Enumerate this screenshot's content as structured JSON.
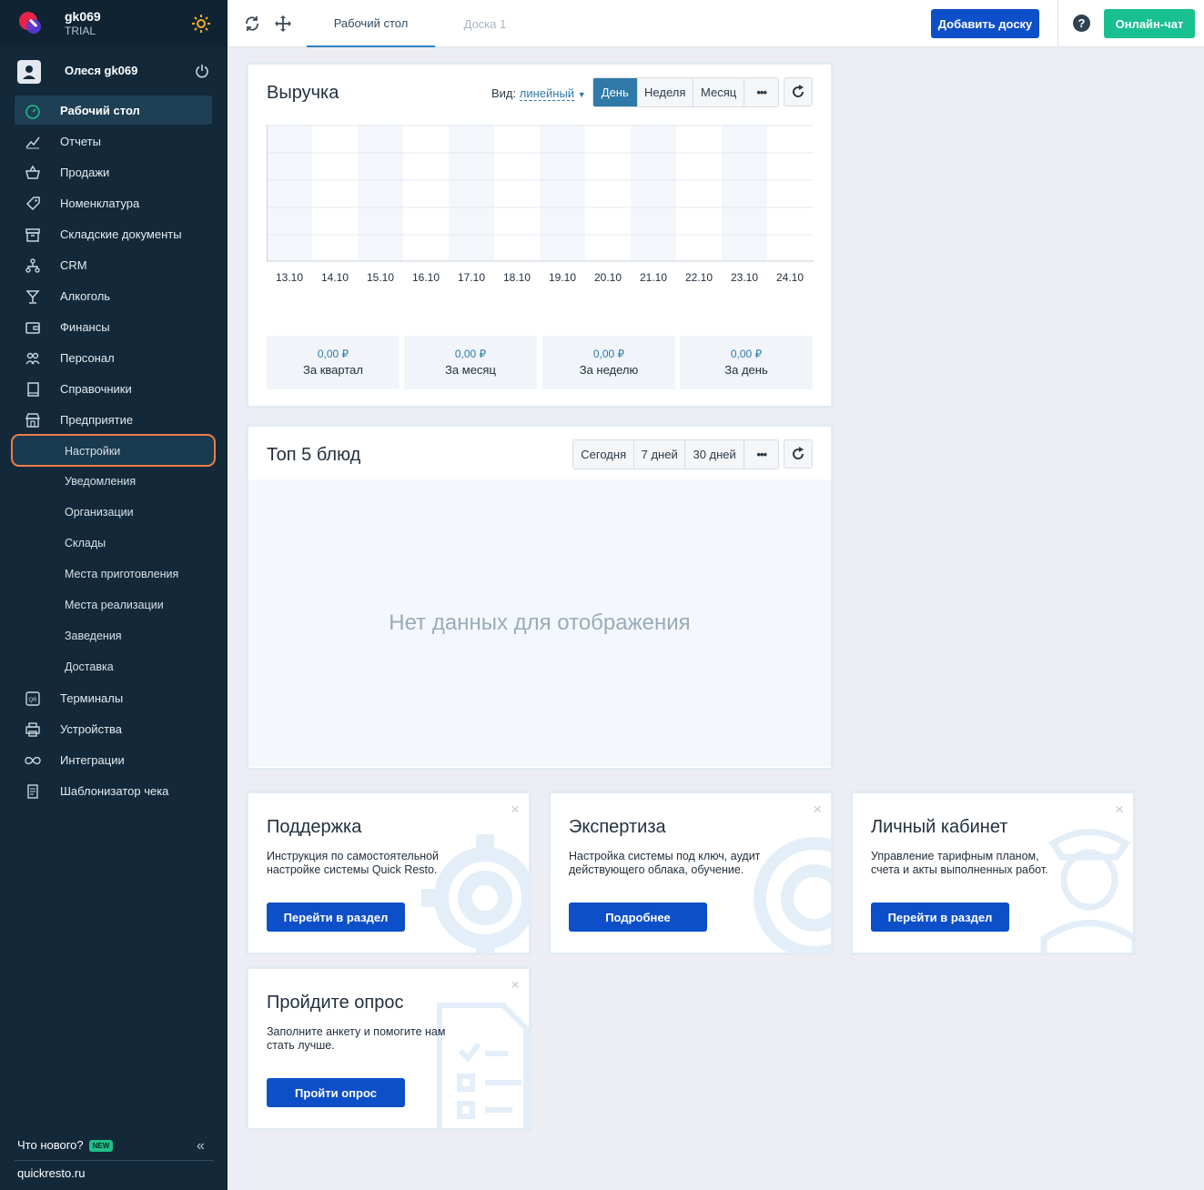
{
  "account": {
    "name": "gk069",
    "plan": "TRIAL"
  },
  "user": {
    "name": "Олеся gk069"
  },
  "nav": {
    "items": [
      {
        "label": "Рабочий стол",
        "icon": "dashboard-icon"
      },
      {
        "label": "Отчеты",
        "icon": "chart-icon"
      },
      {
        "label": "Продажи",
        "icon": "basket-icon"
      },
      {
        "label": "Номенклатура",
        "icon": "tag-icon"
      },
      {
        "label": "Складские документы",
        "icon": "archive-icon"
      },
      {
        "label": "CRM",
        "icon": "crm-icon"
      },
      {
        "label": "Алкоголь",
        "icon": "glass-icon"
      },
      {
        "label": "Финансы",
        "icon": "wallet-icon"
      },
      {
        "label": "Персонал",
        "icon": "people-icon"
      },
      {
        "label": "Справочники",
        "icon": "book-icon"
      },
      {
        "label": "Предприятие",
        "icon": "store-icon"
      }
    ],
    "sub_items": [
      "Настройки",
      "Уведомления",
      "Организации",
      "Склады",
      "Места приготовления",
      "Места реализации",
      "Заведения",
      "Доставка"
    ],
    "items_after": [
      {
        "label": "Терминалы",
        "icon": "qr-icon"
      },
      {
        "label": "Устройства",
        "icon": "printer-icon"
      },
      {
        "label": "Интеграции",
        "icon": "infinity-icon"
      },
      {
        "label": "Шаблонизатор чека",
        "icon": "receipt-icon"
      }
    ]
  },
  "footer": {
    "whats_new": "Что нового?",
    "new_badge": "NEW",
    "site": "quickresto.ru"
  },
  "topbar": {
    "tabs": [
      "Рабочий стол",
      "Доска 1"
    ],
    "add_board": "Добавить доску",
    "help": "?",
    "chat": "Онлайн-чат"
  },
  "revenue": {
    "title": "Выручка",
    "view_label": "Вид:",
    "view_value": "линейный",
    "periods": [
      "День",
      "Неделя",
      "Месяц"
    ],
    "more": "•••",
    "stats": [
      {
        "value": "0,00 ₽",
        "label": "За квартал"
      },
      {
        "value": "0,00 ₽",
        "label": "За месяц"
      },
      {
        "value": "0,00 ₽",
        "label": "За неделю"
      },
      {
        "value": "0,00 ₽",
        "label": "За день"
      }
    ]
  },
  "chart_data": {
    "type": "bar",
    "categories": [
      "13.10",
      "14.10",
      "15.10",
      "16.10",
      "17.10",
      "18.10",
      "19.10",
      "20.10",
      "21.10",
      "22.10",
      "23.10",
      "24.10"
    ],
    "values": [
      0,
      0,
      0,
      0,
      0,
      0,
      0,
      0,
      0,
      0,
      0,
      0
    ],
    "title": "Выручка",
    "grid": true
  },
  "top5": {
    "title": "Топ 5 блюд",
    "periods": [
      "Сегодня",
      "7 дней",
      "30 дней"
    ],
    "more": "•••",
    "empty": "Нет данных для отображения"
  },
  "promos": [
    {
      "title": "Поддержка",
      "desc": "Инструкция по самостоятельной настройке системы Quick Resto.",
      "button": "Перейти в раздел",
      "close": "×"
    },
    {
      "title": "Экспертиза",
      "desc": "Настройка системы под ключ, аудит действующего облака, обучение.",
      "button": "Подробнее",
      "close": "×"
    },
    {
      "title": "Личный кабинет",
      "desc": "Управление тарифным планом, счета и акты выполненных работ.",
      "button": "Перейти в раздел",
      "close": "×"
    },
    {
      "title": "Пройдите опрос",
      "desc": "Заполните анкету и помогите нам стать лучше.",
      "button": "Пройти опрос",
      "close": "×"
    }
  ],
  "colors": {
    "sidebar": "#13293a",
    "accent": "#0d4fc8",
    "chat": "#18c08f",
    "highlight": "#f07c4a",
    "segment_active": "#2f7aa8"
  }
}
